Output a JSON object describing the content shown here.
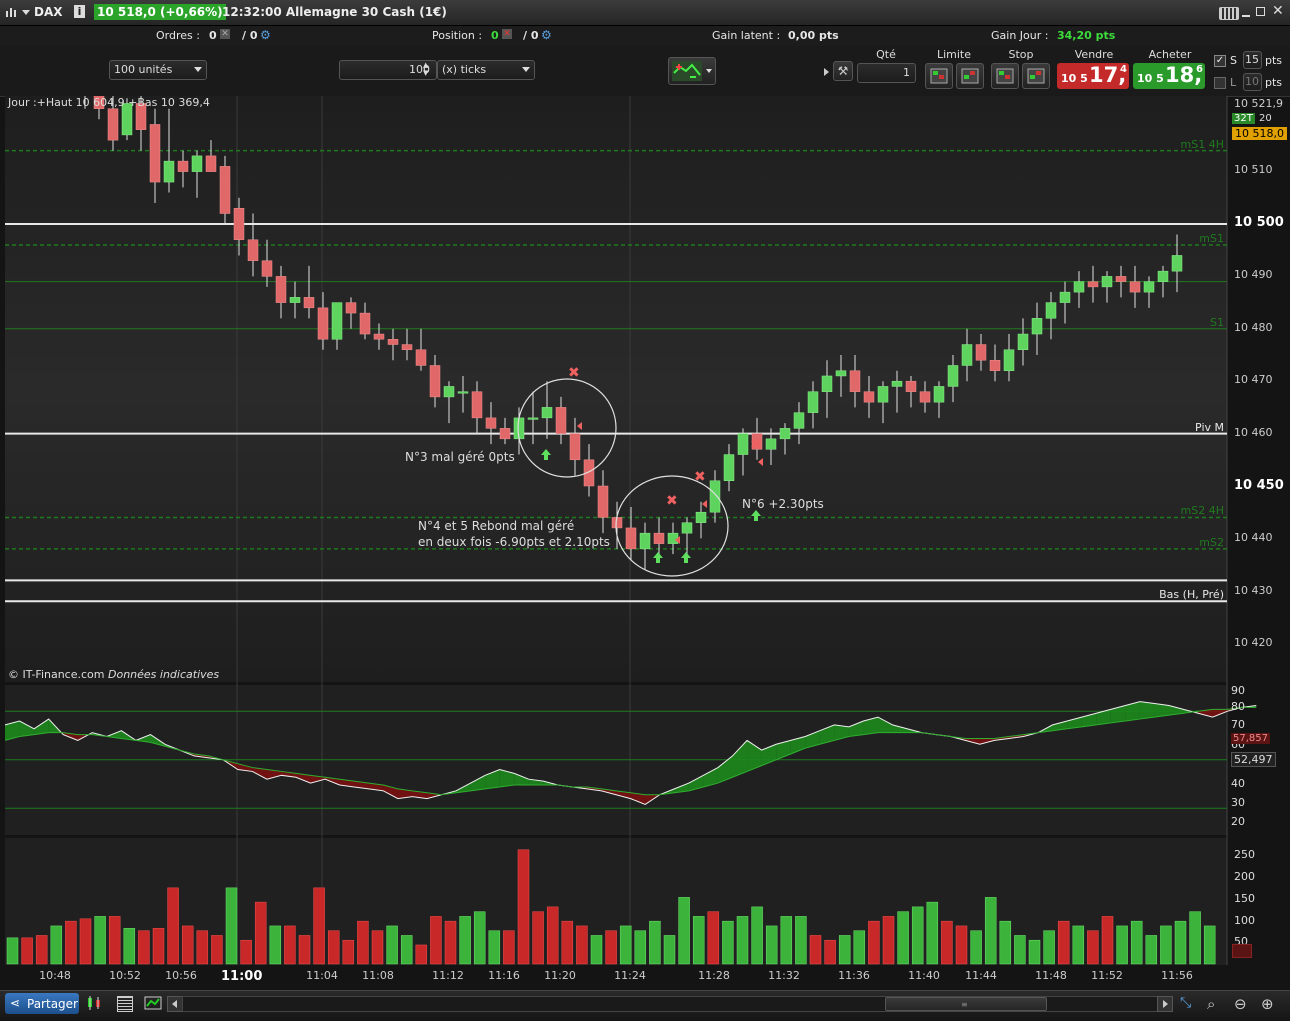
{
  "titlebar": {
    "instrument": "DAX",
    "info_icon": "info-icon",
    "price_badge": "10 518,0 (+0,66%)",
    "time_title": "12:32:00 Allemagne 30 Cash (1€)",
    "colors": {
      "badge": "#2aa52a"
    }
  },
  "statusbar": {
    "orders_label": "Ordres :",
    "orders_value1": "0",
    "orders_value2": "/ 0",
    "position_label": "Position :",
    "position_value1": "0",
    "position_value2": "/ 0",
    "gain_latent_label": "Gain latent :",
    "gain_latent_value": "0,00 pts",
    "gain_jour_label": "Gain Jour :",
    "gain_jour_value": "34,20 pts",
    "colors": {
      "gain_jour": "#3cdc3c"
    }
  },
  "toolbar": {
    "units_select": "100 unités",
    "ticks_value": "100",
    "ticks_select": "(x) ticks",
    "qty_header": "Qté",
    "qty_value": "1",
    "limit_header": "Limite",
    "stop_header": "Stop",
    "sell_header": "Vendre",
    "buy_header": "Acheter",
    "sell_small": "10 5",
    "sell_big": "17,",
    "sell_sup": "4",
    "buy_small": "10 5",
    "buy_big": "18,",
    "buy_sup": "6",
    "s_label": "S",
    "s_value": "15",
    "s_unit": "pts",
    "l_label": "L",
    "l_value": "10",
    "l_unit": "pts",
    "colors": {
      "sell": "#c42a2a",
      "buy": "#2a9a2a"
    }
  },
  "chart_data": {
    "type": "candlestick",
    "header_text": "Jour :+Haut 10 604,9 +Bas 10 369,4",
    "credit": "© IT-Finance.com",
    "credit_italic": "Données indicatives",
    "price_axis": [
      "10 521,9",
      "10 510",
      "10 500",
      "10 490",
      "10 480",
      "10 470",
      "10 460",
      "10 450",
      "10 440",
      "10 430",
      "10 420"
    ],
    "price_axis_bold": [
      "10 500",
      "10 450"
    ],
    "price_badge_top": "32T",
    "price_badge_top2": "20",
    "price_badge_current": "10 518,0",
    "ylim": [
      10414,
      10522
    ],
    "candles": [
      [
        10525,
        10529,
        10522,
        10528
      ],
      [
        10527,
        10530,
        10520,
        10522
      ],
      [
        10522,
        10525,
        10514,
        10516
      ],
      [
        10517,
        10524,
        10516,
        10523
      ],
      [
        10523,
        10526,
        10514,
        10518
      ],
      [
        10519,
        10522,
        10504,
        10508
      ],
      [
        10508,
        10522,
        10506,
        10512
      ],
      [
        10512,
        10514,
        10507,
        10510
      ],
      [
        10510,
        10514,
        10505,
        10513
      ],
      [
        10513,
        10516,
        10510,
        10510
      ],
      [
        10511,
        10513,
        10500,
        10502
      ],
      [
        10503,
        10505,
        10494,
        10497
      ],
      [
        10497,
        10502,
        10490,
        10493
      ],
      [
        10493,
        10497,
        10488,
        10490
      ],
      [
        10490,
        10492,
        10482,
        10485
      ],
      [
        10485,
        10489,
        10482,
        10486
      ],
      [
        10486,
        10492,
        10482,
        10484
      ],
      [
        10484,
        10487,
        10476,
        10478
      ],
      [
        10478,
        10484,
        10476,
        10485
      ],
      [
        10485,
        10486,
        10480,
        10483
      ],
      [
        10483,
        10485,
        10478,
        10479
      ],
      [
        10479,
        10481,
        10476,
        10478
      ],
      [
        10478,
        10480,
        10474,
        10477
      ],
      [
        10477,
        10480,
        10474,
        10476
      ],
      [
        10476,
        10480,
        10472,
        10473
      ],
      [
        10473,
        10475,
        10465,
        10467
      ],
      [
        10467,
        10470,
        10462,
        10469
      ],
      [
        10468,
        10471,
        10464,
        10468
      ],
      [
        10468,
        10470,
        10460,
        10463
      ],
      [
        10463,
        10466,
        10458,
        10461
      ],
      [
        10461,
        10463,
        10458,
        10459
      ],
      [
        10459,
        10465,
        10456,
        10463
      ],
      [
        10463,
        10468,
        10458,
        10463
      ],
      [
        10463,
        10470,
        10459,
        10465
      ],
      [
        10465,
        10467,
        10458,
        10460
      ],
      [
        10460,
        10463,
        10452,
        10455
      ],
      [
        10455,
        10458,
        10448,
        10450
      ],
      [
        10450,
        10453,
        10441,
        10444
      ],
      [
        10444,
        10447,
        10438,
        10442
      ],
      [
        10442,
        10446,
        10436,
        10438
      ],
      [
        10438,
        10443,
        10434,
        10441
      ],
      [
        10441,
        10444,
        10436,
        10439
      ],
      [
        10439,
        10443,
        10437,
        10441
      ],
      [
        10441,
        10444,
        10437,
        10443
      ],
      [
        10443,
        10447,
        10440,
        10445
      ],
      [
        10445,
        10453,
        10443,
        10451
      ],
      [
        10451,
        10458,
        10449,
        10456
      ],
      [
        10456,
        10461,
        10452,
        10460
      ],
      [
        10460,
        10463,
        10455,
        10457
      ],
      [
        10457,
        10461,
        10454,
        10459
      ],
      [
        10459,
        10462,
        10456,
        10461
      ],
      [
        10461,
        10466,
        10458,
        10464
      ],
      [
        10464,
        10470,
        10461,
        10468
      ],
      [
        10468,
        10474,
        10463,
        10471
      ],
      [
        10471,
        10475,
        10467,
        10472
      ],
      [
        10472,
        10475,
        10465,
        10468
      ],
      [
        10468,
        10471,
        10463,
        10466
      ],
      [
        10466,
        10470,
        10462,
        10469
      ],
      [
        10469,
        10472,
        10464,
        10470
      ],
      [
        10470,
        10471,
        10465,
        10468
      ],
      [
        10468,
        10470,
        10464,
        10466
      ],
      [
        10466,
        10470,
        10463,
        10469
      ],
      [
        10469,
        10475,
        10466,
        10473
      ],
      [
        10473,
        10480,
        10470,
        10477
      ],
      [
        10477,
        10479,
        10472,
        10474
      ],
      [
        10474,
        10477,
        10470,
        10472
      ],
      [
        10472,
        10479,
        10470,
        10476
      ],
      [
        10476,
        10482,
        10473,
        10479
      ],
      [
        10479,
        10485,
        10475,
        10482
      ],
      [
        10482,
        10487,
        10478,
        10485
      ],
      [
        10485,
        10489,
        10481,
        10487
      ],
      [
        10487,
        10491,
        10484,
        10489
      ],
      [
        10489,
        10492,
        10485,
        10488
      ],
      [
        10488,
        10491,
        10485,
        10490
      ],
      [
        10490,
        10492,
        10486,
        10489
      ],
      [
        10489,
        10492,
        10484,
        10487
      ],
      [
        10487,
        10490,
        10484,
        10489
      ],
      [
        10489,
        10492,
        10486,
        10491
      ],
      [
        10491,
        10498,
        10487,
        10494
      ]
    ],
    "levels": [
      {
        "price": 10500,
        "style": "solid-white",
        "label": ""
      },
      {
        "price": 10460,
        "style": "solid-white",
        "label": "Piv M"
      },
      {
        "price": 10432,
        "style": "solid-white",
        "label": ""
      },
      {
        "price": 10428,
        "style": "solid-white",
        "label": "Bas (H, Pré)"
      },
      {
        "price": 10496,
        "style": "dashed-green",
        "label": "mS1"
      },
      {
        "price": 10489,
        "style": "solid-green",
        "label": ""
      },
      {
        "price": 10480,
        "style": "solid-green",
        "label": "S1"
      },
      {
        "price": 10444,
        "style": "dashed-green",
        "label": "mS2 4H"
      },
      {
        "price": 10438,
        "style": "dashed-green",
        "label": "mS2"
      },
      {
        "price": 10514,
        "style": "dashed-green",
        "label": "mS1 4H"
      }
    ],
    "annotations": [
      {
        "text": "N°3 mal géré 0pts"
      },
      {
        "text": "N°4 et 5 Rebond mal géré"
      },
      {
        "text": "en deux fois -6.90pts et 2.10pts"
      },
      {
        "text": "N°6 +2.30pts"
      }
    ],
    "time_axis": [
      "10:48",
      "10:52",
      "10:56",
      "11:00",
      "11:04",
      "11:08",
      "11:12",
      "11:16",
      "11:20",
      "11:24",
      "11:28",
      "11:32",
      "11:36",
      "11:40",
      "11:44",
      "11:48",
      "11:52",
      "11:56"
    ],
    "time_axis_bold": "11:00",
    "osc_axis": [
      "90",
      "80",
      "70",
      "60",
      "52,497",
      "40",
      "30",
      "20"
    ],
    "osc_current": "52,497",
    "osc_red_badge": "57,857",
    "osc_line": [
      68,
      70,
      66,
      71,
      63,
      60,
      64,
      62,
      65,
      60,
      63,
      58,
      55,
      52,
      51,
      50,
      45,
      44,
      40,
      42,
      41,
      38,
      40,
      37,
      36,
      35,
      34,
      30,
      31,
      30,
      32,
      34,
      38,
      42,
      45,
      43,
      40,
      39,
      37,
      36,
      35,
      34,
      32,
      30,
      27,
      32,
      35,
      38,
      42,
      46,
      52,
      60,
      55,
      58,
      60,
      62,
      65,
      68,
      67,
      70,
      72,
      68,
      66,
      64,
      63,
      62,
      60,
      58,
      60,
      61,
      62,
      64,
      68,
      70,
      72,
      74,
      76,
      78,
      80,
      79,
      78,
      76,
      74,
      72,
      75,
      77,
      78
    ],
    "osc_signal": [
      60,
      62,
      63,
      64,
      64,
      63,
      63,
      62,
      61,
      60,
      59,
      57,
      55,
      53,
      52,
      50,
      48,
      46,
      45,
      44,
      43,
      42,
      41,
      40,
      39,
      38,
      37,
      35,
      34,
      33,
      32,
      33,
      34,
      35,
      36,
      37,
      37,
      37,
      37,
      36,
      36,
      35,
      34,
      33,
      32,
      32,
      33,
      34,
      36,
      38,
      41,
      44,
      47,
      50,
      53,
      56,
      58,
      60,
      62,
      63,
      64,
      64,
      64,
      64,
      63,
      62,
      61,
      61,
      61,
      62,
      63,
      64,
      65,
      66,
      67,
      68,
      69,
      70,
      71,
      72,
      73,
      74,
      75,
      76,
      76,
      77,
      77
    ],
    "vol_axis": [
      "250",
      "200",
      "150",
      "100",
      "50"
    ],
    "volumes": [
      55,
      55,
      60,
      80,
      90,
      95,
      100,
      100,
      75,
      70,
      75,
      160,
      80,
      70,
      60,
      160,
      50,
      130,
      80,
      80,
      60,
      160,
      70,
      50,
      90,
      70,
      80,
      60,
      40,
      100,
      90,
      100,
      110,
      70,
      70,
      240,
      110,
      120,
      90,
      80,
      60,
      70,
      80,
      70,
      90,
      60,
      140,
      100,
      110,
      90,
      100,
      120,
      80,
      100,
      100,
      60,
      50,
      60,
      70,
      90,
      100,
      110,
      120,
      130,
      90,
      80,
      70,
      140,
      90,
      60,
      50,
      70,
      90,
      80,
      70,
      100,
      80,
      90,
      60,
      80,
      90,
      110,
      80
    ]
  },
  "bottombar": {
    "share_label": "Partager",
    "icons": [
      "share-icon",
      "candle-type-icon",
      "print-icon",
      "chart-settings-icon",
      "zoom-fit-icon",
      "zoom-out-icon",
      "zoom-in-icon"
    ]
  },
  "window_icons": [
    "keyboard-icon",
    "minimize-icon",
    "restore-icon",
    "close-icon"
  ]
}
